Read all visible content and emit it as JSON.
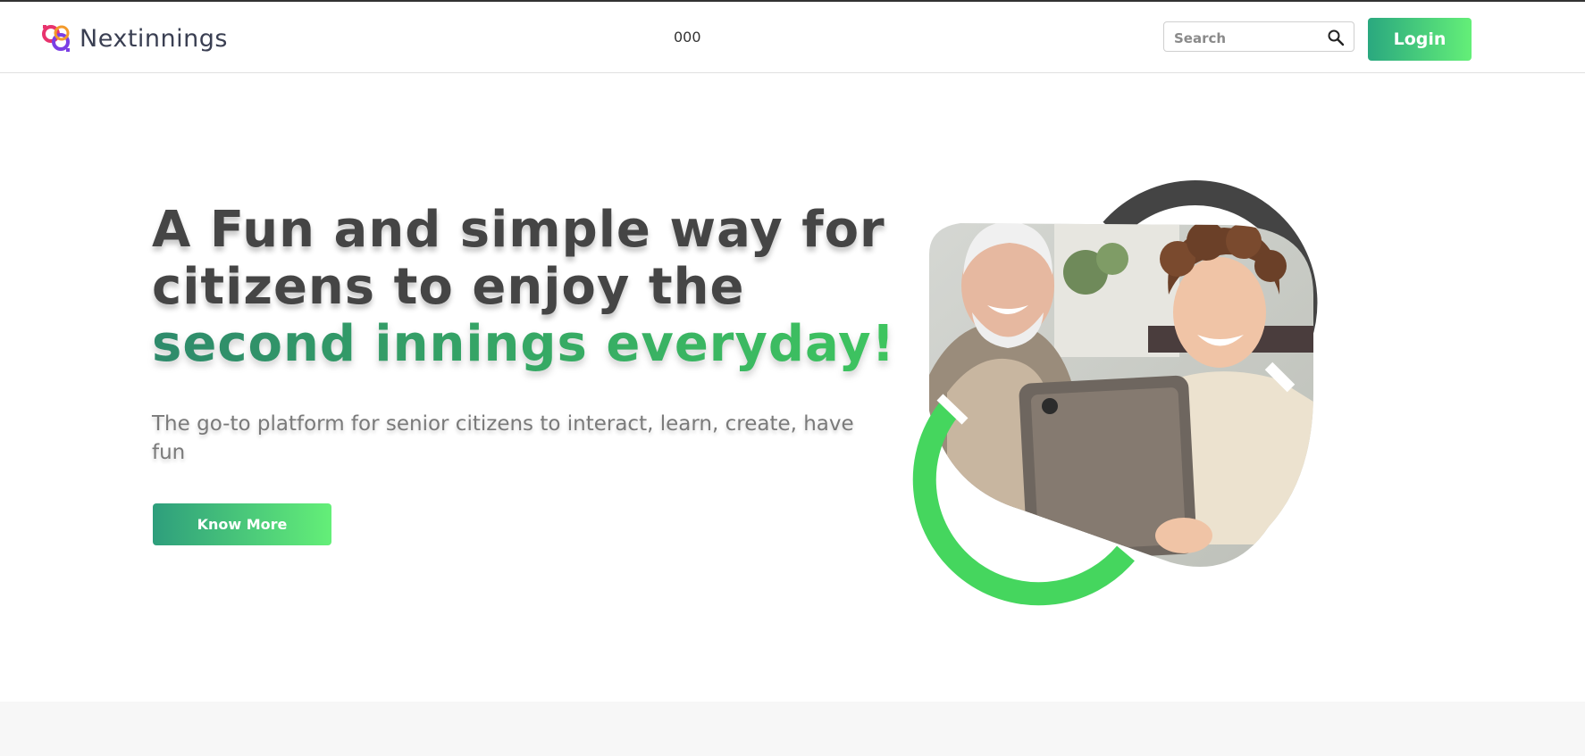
{
  "brand": {
    "name": "Nextinnings"
  },
  "nav": {
    "center_text": "000"
  },
  "search": {
    "placeholder": "Search"
  },
  "header": {
    "login_label": "Login"
  },
  "hero": {
    "title_line1": "A Fun and simple way for",
    "title_line2": "citizens to enjoy the",
    "title_accent": "second innings everyday!",
    "subtitle": "The go-to platform for senior citizens to interact, learn, create, have fun",
    "cta_label": "Know More"
  },
  "colors": {
    "accent_start": "#2aa87f",
    "accent_end": "#64ef78",
    "dark_ring": "#444444",
    "green_ring": "#45d65e"
  },
  "icons": [
    "logo-icon",
    "search-icon"
  ]
}
